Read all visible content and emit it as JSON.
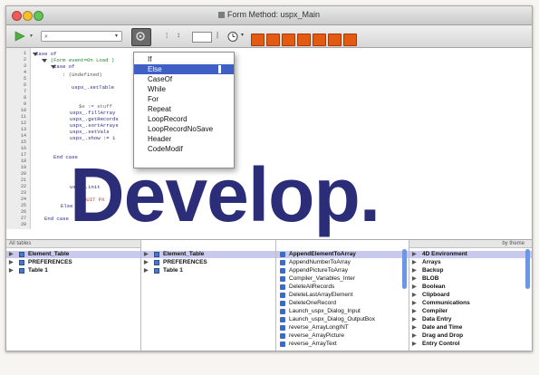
{
  "window": {
    "title": "Form Method: uspx_Main"
  },
  "colors": {
    "close": "#f05b57",
    "minimize": "#f5bf2b",
    "maximize": "#62c554",
    "accent": "#3f5fc5",
    "tool_orange": "#e35b12",
    "overlay_text": "#2b2d78"
  },
  "toolbar": {
    "run_icon": "play-icon",
    "settings_icon": "gear-icon"
  },
  "dropdown": {
    "items": [
      "If",
      "Else",
      "CaseOf",
      "While",
      "For",
      "Repeat",
      "LoopRecord",
      "LoopRecordNoSave",
      "Header",
      "CodeModif"
    ],
    "selected_index": 1
  },
  "editor": {
    "lines": [
      "1",
      "2",
      "3",
      "4",
      "5",
      "6",
      "7",
      "8",
      "9",
      "10",
      "11",
      "12",
      "13",
      "14",
      "15",
      "16",
      "17",
      "18",
      "19",
      "20",
      "21",
      "22",
      "23",
      "24",
      "25",
      "26",
      "27",
      "28"
    ],
    "code": [
      "Case of",
      ": (Form event=On Load )",
      "Case of",
      ": (Undefined)",
      "uspx_.setTable",
      "$e := stuff",
      "uspx_.fillArray",
      "uspx_.getRecords",
      "uspx_.sortArrays",
      "uspx_.setVals",
      "uspx_.show := 1",
      "End case",
      "uspx_.init",
      "QUIT PX",
      "Else",
      "End case"
    ]
  },
  "overlay": {
    "text": "Develop."
  },
  "lists": {
    "col1_head": "All tables",
    "col1": [
      "Element_Table",
      "PREFERENCES",
      "Table 1"
    ],
    "col2": [
      "Element_Table",
      "PREFERENCES",
      "Table 1"
    ],
    "col3": [
      "AppendElementToArray",
      "AppendNumberToArray",
      "AppendPictureToArray",
      "Compiler_Variables_Inter",
      "DeleteAllRecords",
      "DeleteLastArrayElement",
      "DeleteOneRecord",
      "Launch_uspx_Dialog_Input",
      "Launch_uspx_Dialog_OutputBox",
      "reverse_ArrayLongINT",
      "reverse_ArrayPicture",
      "reverse_ArrayText"
    ],
    "col4_head": "by theme",
    "col4": [
      "4D Environment",
      "Arrays",
      "Backup",
      "BLOB",
      "Boolean",
      "Clipboard",
      "Communications",
      "Compiler",
      "Data Entry",
      "Date and Time",
      "Drag and Drop",
      "Entry Control"
    ]
  }
}
